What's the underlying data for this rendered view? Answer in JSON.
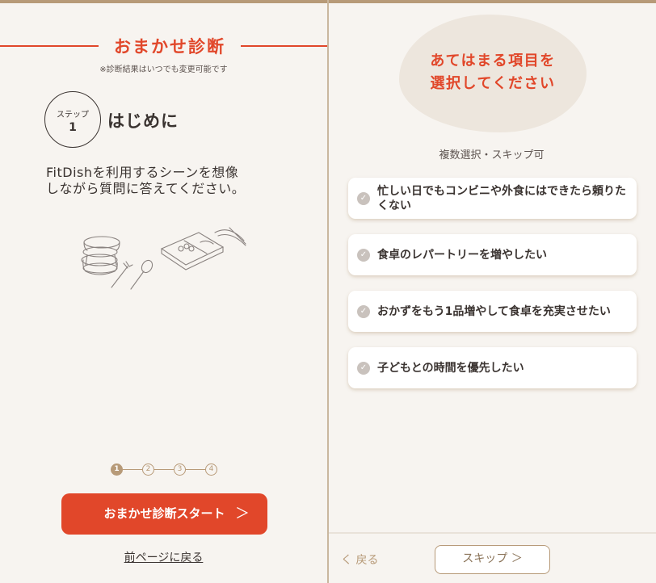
{
  "left": {
    "title": "おまかせ診断",
    "subnote": "※診断結果はいつでも変更可能です",
    "step": {
      "label": "ステップ",
      "number": "1",
      "heading": "はじめに"
    },
    "intro_lines": [
      "FitDishを利用するシーンを想像",
      "しながら質問に答えてください。"
    ],
    "stepper": [
      "1",
      "2",
      "3",
      "4"
    ],
    "start_button": "おまかせ診断スタート",
    "start_chevron": "＞",
    "back_link": "前ページに戻る"
  },
  "right": {
    "prompt_lines": [
      "あてはまる項目を",
      "選択してください"
    ],
    "hint": "複数選択・スキップ可",
    "options": [
      "忙しい日でもコンビニや外食にはできたら頼りたくない",
      "食卓のレパートリーを増やしたい",
      "おかずをもう1品増やして食卓を充実させたい",
      "子どもとの時間を優先したい"
    ],
    "footer_back": "く 戻る",
    "skip_button": "スキップ ＞"
  },
  "colors": {
    "accent": "#e1472a",
    "tan": "#b79a78",
    "background": "#f7f4f0"
  }
}
